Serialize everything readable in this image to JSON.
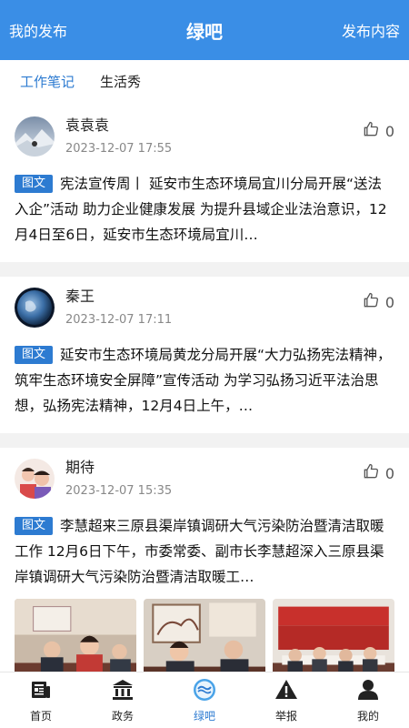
{
  "header": {
    "left": "我的发布",
    "title": "绿吧",
    "right": "发布内容"
  },
  "tabs": [
    {
      "label": "工作笔记",
      "active": true
    },
    {
      "label": "生活秀",
      "active": false
    }
  ],
  "posts": [
    {
      "author": "袁袁袁",
      "time": "2023-12-07 17:55",
      "likes": "0",
      "badge": "图文",
      "text": "宪法宣传周丨 延安市生态环境局宜川分局开展“送法入企”活动 助力企业健康发展 为提升县域企业法治意识，12月4日至6日，延安市生态环境局宜川…"
    },
    {
      "author": "秦王",
      "time": "2023-12-07 17:11",
      "likes": "0",
      "badge": "图文",
      "text": "延安市生态环境局黄龙分局开展“大力弘扬宪法精神，筑牢生态环境安全屏障”宣传活动 为学习弘扬习近平法治思想，弘扬宪法精神，12月4日上午，…"
    },
    {
      "author": "期待",
      "time": "2023-12-07 15:35",
      "likes": "0",
      "badge": "图文",
      "text": "李慧超来三原县渠岸镇调研大气污染防治暨清洁取暖工作 12月6日下午，市委常委、副市长李慧超深入三原县渠岸镇调研大气污染防治暨清洁取暖工…"
    }
  ],
  "nav": [
    {
      "label": "首页",
      "icon": "news-icon",
      "active": false
    },
    {
      "label": "政务",
      "icon": "government-building-icon",
      "active": false
    },
    {
      "label": "绿吧",
      "icon": "green-bar-logo-icon",
      "active": true
    },
    {
      "label": "举报",
      "icon": "warning-icon",
      "active": false
    },
    {
      "label": "我的",
      "icon": "user-icon",
      "active": false
    }
  ],
  "colors": {
    "primary": "#3a8ee6",
    "accent": "#2d7bd1",
    "badge": "#2d7bd1"
  }
}
